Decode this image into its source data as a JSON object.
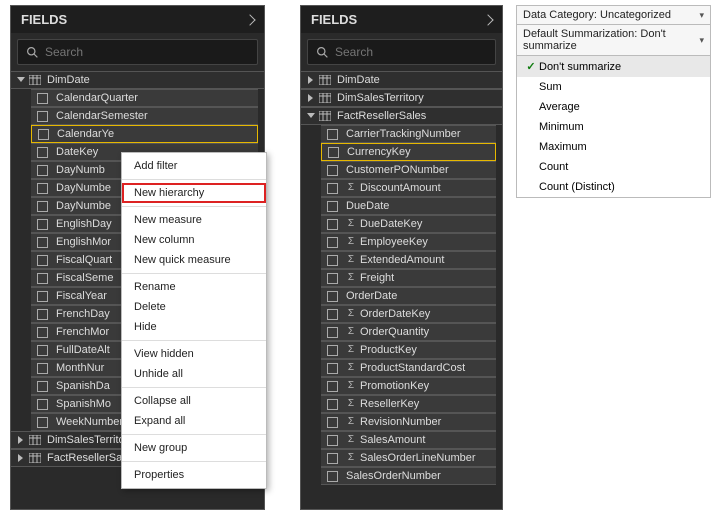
{
  "panel1": {
    "title": "FIELDS",
    "search_placeholder": "Search",
    "tables": [
      {
        "name": "DimDate",
        "expanded": true,
        "selected_index": 2,
        "fields": [
          "CalendarQuarter",
          "CalendarSemester",
          "CalendarYear",
          "DateKey",
          "DayNumberOfMonth",
          "DayNumberOfWeek",
          "DayNumberOfYear",
          "EnglishDayNameOfWeek",
          "EnglishMonthName",
          "FiscalQuarter",
          "FiscalSemester",
          "FiscalYear",
          "FrenchDayNameOfWeek",
          "FrenchMonthName",
          "FullDateAlternateKey",
          "MonthNumberOfYear",
          "SpanishDayNameOfWeek",
          "SpanishMonthName",
          "WeekNumberOfYear"
        ]
      },
      {
        "name": "DimSalesTerritory",
        "expanded": false,
        "fields": []
      },
      {
        "name": "FactResellerSales",
        "expanded": false,
        "fields": []
      }
    ]
  },
  "context_menu": {
    "groups": [
      [
        "Add filter"
      ],
      [
        "New hierarchy"
      ],
      [
        "New measure",
        "New column",
        "New quick measure"
      ],
      [
        "Rename",
        "Delete",
        "Hide"
      ],
      [
        "View hidden",
        "Unhide all"
      ],
      [
        "Collapse all",
        "Expand all"
      ],
      [
        "New group"
      ],
      [
        "Properties"
      ]
    ],
    "highlight": "New hierarchy"
  },
  "panel2": {
    "title": "FIELDS",
    "search_placeholder": "Search",
    "tables": [
      {
        "name": "DimDate",
        "expanded": false,
        "fields": []
      },
      {
        "name": "DimSalesTerritory",
        "expanded": false,
        "fields": []
      },
      {
        "name": "FactResellerSales",
        "expanded": true,
        "selected_index": 1,
        "fields": [
          {
            "n": "CarrierTrackingNumber",
            "s": false
          },
          {
            "n": "CurrencyKey",
            "s": false
          },
          {
            "n": "CustomerPONumber",
            "s": false
          },
          {
            "n": "DiscountAmount",
            "s": true
          },
          {
            "n": "DueDate",
            "s": false
          },
          {
            "n": "DueDateKey",
            "s": true
          },
          {
            "n": "EmployeeKey",
            "s": true
          },
          {
            "n": "ExtendedAmount",
            "s": true
          },
          {
            "n": "Freight",
            "s": true
          },
          {
            "n": "OrderDate",
            "s": false
          },
          {
            "n": "OrderDateKey",
            "s": true
          },
          {
            "n": "OrderQuantity",
            "s": true
          },
          {
            "n": "ProductKey",
            "s": true
          },
          {
            "n": "ProductStandardCost",
            "s": true
          },
          {
            "n": "PromotionKey",
            "s": true
          },
          {
            "n": "ResellerKey",
            "s": true
          },
          {
            "n": "RevisionNumber",
            "s": true
          },
          {
            "n": "SalesAmount",
            "s": true
          },
          {
            "n": "SalesOrderLineNumber",
            "s": true
          },
          {
            "n": "SalesOrderNumber",
            "s": false
          }
        ]
      }
    ]
  },
  "dropdown": {
    "row1_label": "Data Category:",
    "row1_value": "Uncategorized",
    "row2_label": "Default Summarization:",
    "row2_value": "Don't summarize",
    "options": [
      "Don't summarize",
      "Sum",
      "Average",
      "Minimum",
      "Maximum",
      "Count",
      "Count (Distinct)"
    ],
    "selected_option": "Don't summarize"
  }
}
